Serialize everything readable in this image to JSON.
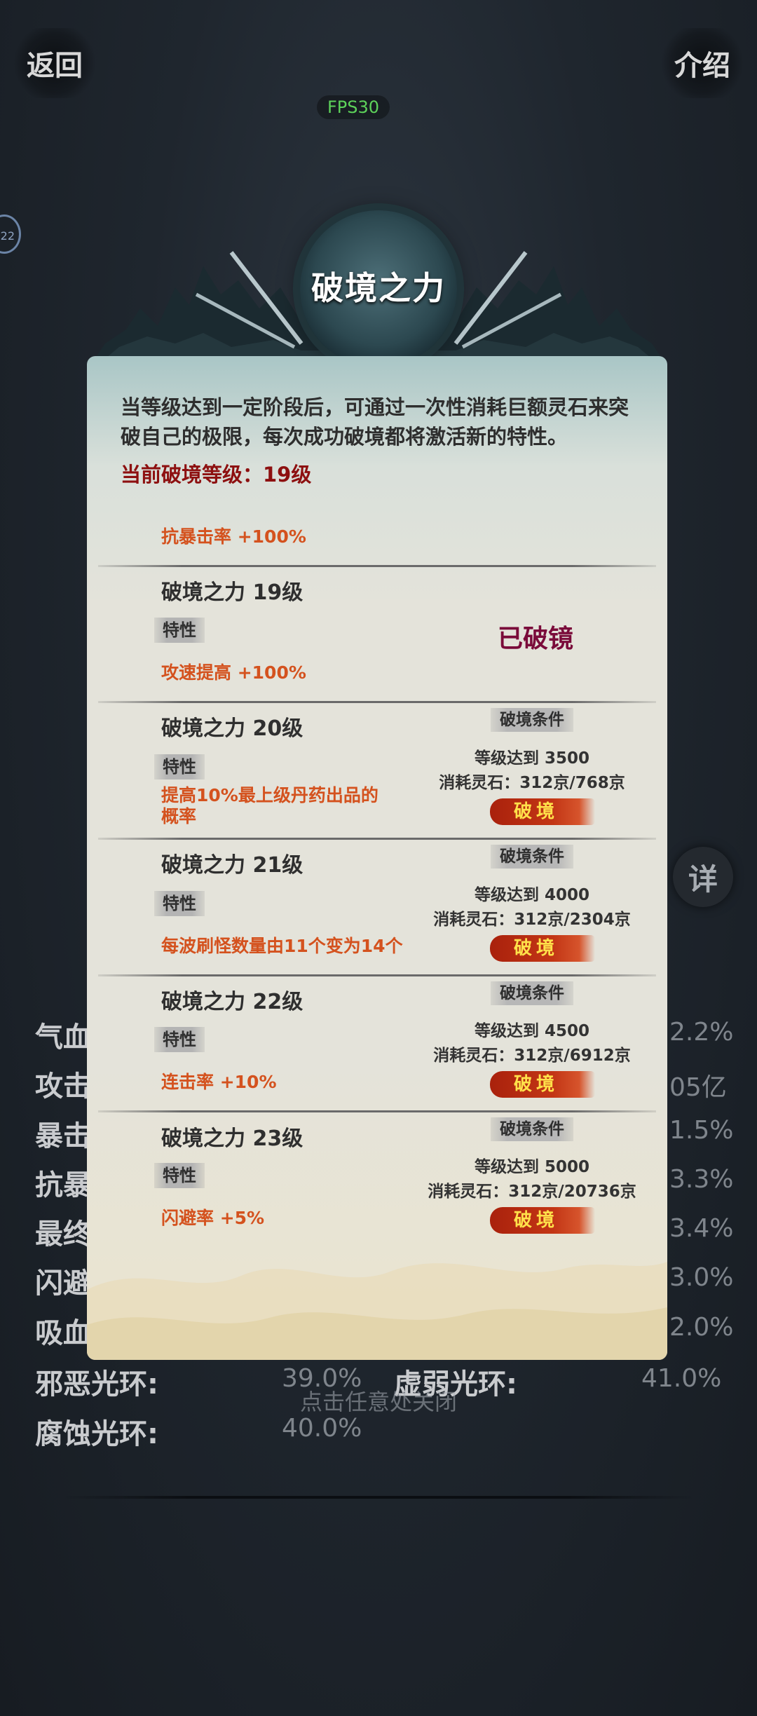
{
  "top_bar": {
    "back_label": "返回",
    "intro_label": "介绍",
    "fps": "FPS30"
  },
  "side_badge": "22",
  "detail_label": "详",
  "background_stats": {
    "left_rows": [
      "气血",
      "攻击",
      "暴击",
      "抗暴",
      "最终",
      "闪避",
      "吸血"
    ],
    "right_values": [
      "2.2%",
      "05亿",
      "1.5%",
      "3.3%",
      "3.4%",
      "3.0%",
      "2.0%"
    ],
    "auras": [
      {
        "label": "邪恶光环:",
        "value": "39.0%"
      },
      {
        "label": "虚弱光环:",
        "value": "41.0%"
      },
      {
        "label": "腐蚀光环:",
        "value": "40.0%"
      }
    ]
  },
  "close_hint": "点击任意处关闭",
  "popup": {
    "title": "破境之力",
    "description": "当等级达到一定阶段后，可通过一次性消耗巨额灵石来突破自己的极限，每次成功破境都将激活新的特性。",
    "current_level": "当前破境等级：19级",
    "top_trait": "抗暴击率 +100%",
    "rows": [
      {
        "name": "破境之力 19级",
        "trait_tag": "特性",
        "trait": "攻速提高 +100%",
        "status": "已破镜"
      },
      {
        "name": "破境之力 20级",
        "trait_tag": "特性",
        "trait": "提高10%最上级丹药出品的概率",
        "cond_tag": "破境条件",
        "cond_level": "等级达到 3500",
        "cond_cost": "消耗灵石：312京/768京",
        "button": "破境"
      },
      {
        "name": "破境之力 21级",
        "trait_tag": "特性",
        "trait": "每波刷怪数量由11个变为14个",
        "cond_tag": "破境条件",
        "cond_level": "等级达到 4000",
        "cond_cost": "消耗灵石：312京/2304京",
        "button": "破境"
      },
      {
        "name": "破境之力 22级",
        "trait_tag": "特性",
        "trait": "连击率 +10%",
        "cond_tag": "破境条件",
        "cond_level": "等级达到 4500",
        "cond_cost": "消耗灵石：312京/6912京",
        "button": "破境"
      },
      {
        "name": "破境之力 23级",
        "trait_tag": "特性",
        "trait": "闪避率 +5%",
        "cond_tag": "破境条件",
        "cond_level": "等级达到 5000",
        "cond_cost": "消耗灵石：312京/20736京",
        "button": "破境"
      }
    ]
  }
}
